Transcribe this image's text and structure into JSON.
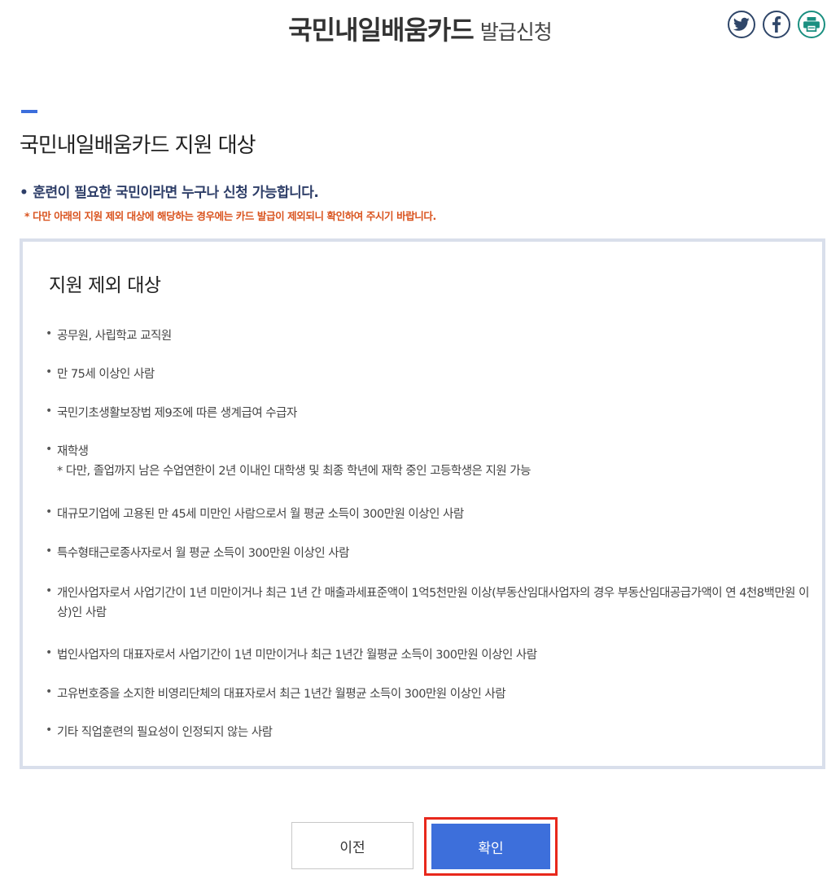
{
  "header": {
    "title_main": "국민내일배움카드",
    "title_sub": "발급신청",
    "share": [
      {
        "icon": "twitter-icon",
        "label": "twitter"
      },
      {
        "icon": "facebook-icon",
        "label": "facebook"
      },
      {
        "icon": "printer-icon",
        "label": "print"
      }
    ]
  },
  "section": {
    "title": "국민내일배움카드 지원 대상",
    "notice_main": "훈련이 필요한 국민이라면 누구나 신청 가능합니다.",
    "notice_sub": "* 다만 아래의 지원 제외 대상에 해당하는 경우에는 카드 발급이 제외되니 확인하여 주시기 바랍니다."
  },
  "exclusion": {
    "title": "지원 제외 대상",
    "items": [
      {
        "text": "공무원, 사립학교 교직원"
      },
      {
        "text": "만 75세 이상인 사람"
      },
      {
        "text": "국민기초생활보장법 제9조에 따른 생계급여 수급자"
      },
      {
        "text": "재학생",
        "note": "* 다만, 졸업까지 남은 수업연한이 2년 이내인 대학생 및 최종 학년에 재학 중인 고등학생은 지원 가능"
      },
      {
        "text": "대규모기업에 고용된 만 45세 미만인 사람으로서 월 평균 소득이 300만원 이상인 사람"
      },
      {
        "text": "특수형태근로종사자로서 월 평균 소득이 300만원 이상인 사람"
      },
      {
        "text": "개인사업자로서 사업기간이 1년 미만이거나 최근 1년 간 매출과세표준액이 1억5천만원 이상(부동산임대사업자의 경우 부동산임대공급가액이 연 4천8백만원 이상)인 사람"
      },
      {
        "text": "법인사업자의 대표자로서 사업기간이 1년 미만이거나 최근 1년간 월평균 소득이 300만원 이상인 사람"
      },
      {
        "text": "고유번호증을 소지한 비영리단체의 대표자로서 최근 1년간 월평균 소득이 300만원 이상인 사람"
      },
      {
        "text": "기타 직업훈련의 필요성이 인정되지 않는 사람"
      }
    ]
  },
  "buttons": {
    "prev_label": "이전",
    "confirm_label": "확인"
  },
  "colors": {
    "accent": "#3d6fdb",
    "notice_main": "#2e3e68",
    "notice_sub": "#d9531e",
    "box_border": "#d9dfeb",
    "highlight": "#e8281c"
  }
}
